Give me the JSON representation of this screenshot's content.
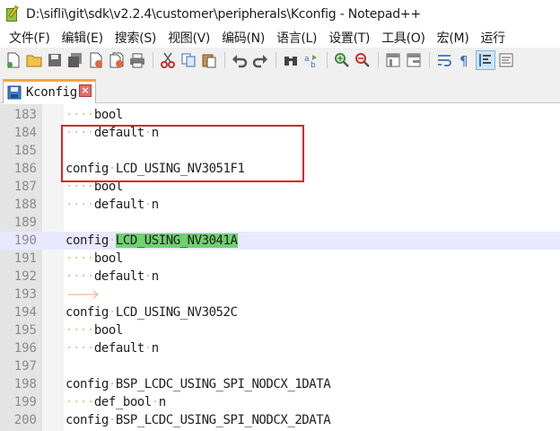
{
  "window": {
    "title": "D:\\sifli\\git\\sdk\\v2.2.4\\customer\\peripherals\\Kconfig - Notepad++"
  },
  "menu": [
    "文件(F)",
    "编辑(E)",
    "搜索(S)",
    "视图(V)",
    "编码(N)",
    "语言(L)",
    "设置(T)",
    "工具(O)",
    "宏(M)",
    "运行"
  ],
  "tab": {
    "label": "Kconfig",
    "close": "×"
  },
  "lines": [
    {
      "num": "183",
      "indent": true,
      "text": "bool"
    },
    {
      "num": "184",
      "indent": true,
      "text": "default n"
    },
    {
      "num": "185",
      "indent": false,
      "text": ""
    },
    {
      "num": "186",
      "indent": false,
      "text": "config LCD_USING_NV3051F1"
    },
    {
      "num": "187",
      "indent": true,
      "text": "bool"
    },
    {
      "num": "188",
      "indent": true,
      "text": "default n"
    },
    {
      "num": "189",
      "indent": false,
      "text": ""
    },
    {
      "num": "190",
      "indent": false,
      "text": "config LCD_USING_NV3041A",
      "current": true,
      "highlight": "LCD_USING_NV3041A"
    },
    {
      "num": "191",
      "indent": true,
      "text": "bool"
    },
    {
      "num": "192",
      "indent": true,
      "text": "default n"
    },
    {
      "num": "193",
      "indent": false,
      "text": "",
      "tab_arrow": true
    },
    {
      "num": "194",
      "indent": false,
      "text": "config LCD_USING_NV3052C"
    },
    {
      "num": "195",
      "indent": true,
      "text": "bool"
    },
    {
      "num": "196",
      "indent": true,
      "text": "default n"
    },
    {
      "num": "197",
      "indent": false,
      "text": ""
    },
    {
      "num": "198",
      "indent": false,
      "text": "config BSP_LCDC_USING_SPI_NODCX_1DATA"
    },
    {
      "num": "199",
      "indent": true,
      "text": "def_bool n"
    },
    {
      "num": "200",
      "indent": false,
      "text": "config BSP_LCDC_USING_SPI_NODCX_2DATA"
    }
  ],
  "colors": {
    "highlight": "#6fd16f",
    "annotation_box": "#d9232e",
    "current_line": "#e8e8ff",
    "whitespace_dot": "#f2b98c"
  }
}
